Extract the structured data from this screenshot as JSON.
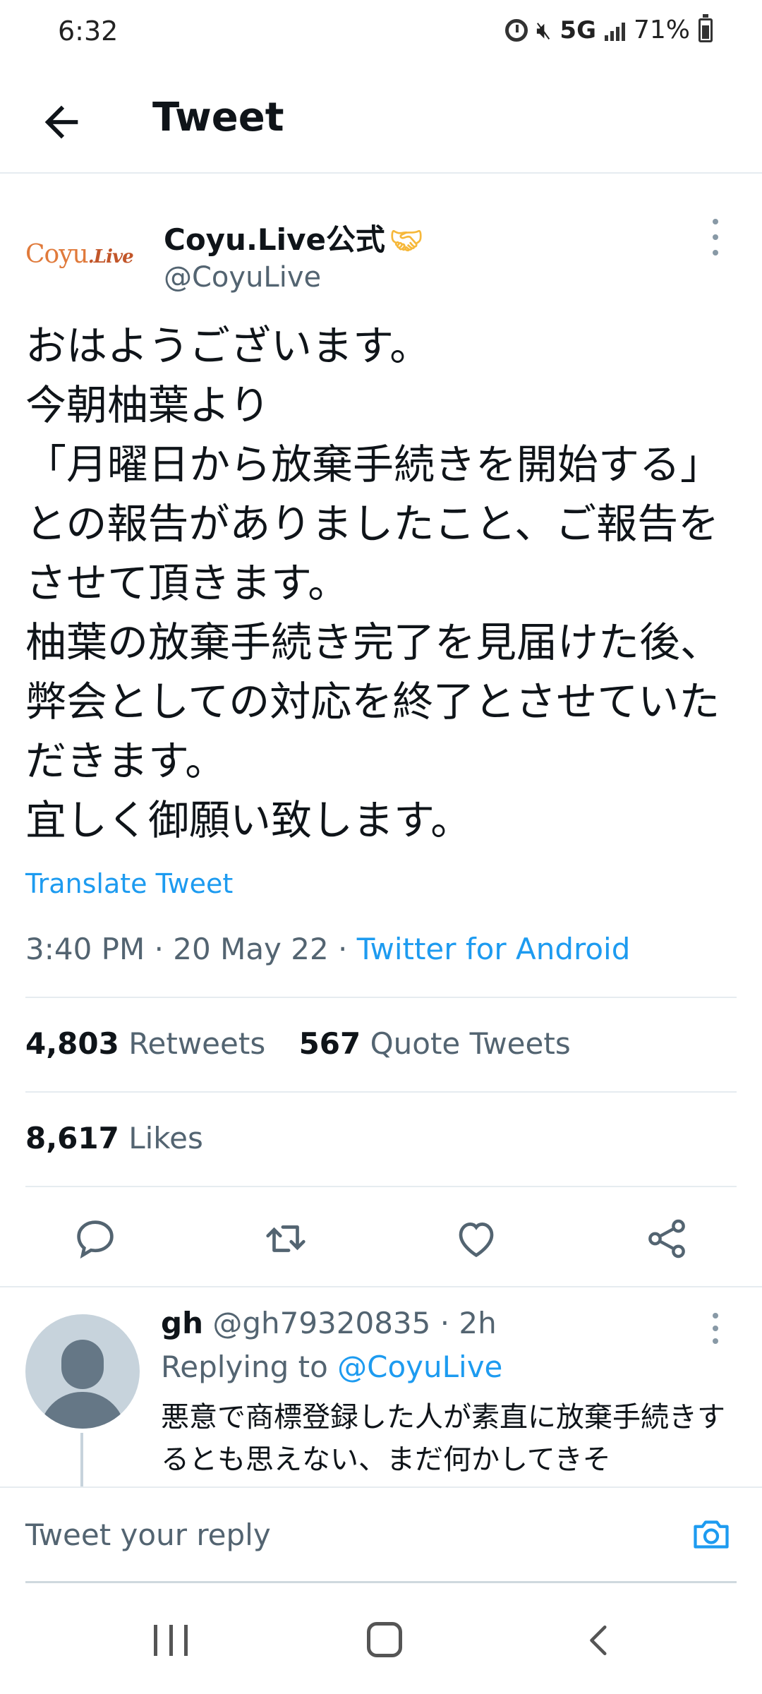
{
  "status_bar": {
    "time": "6:32",
    "network": "5G",
    "battery": "71%"
  },
  "app_bar": {
    "title": "Tweet"
  },
  "tweet": {
    "logo_text": "Coyu",
    "logo_text_accent": ".Live",
    "display_name": "Coyu.Live公式",
    "handle": "@CoyuLive",
    "text": "おはようございます。\n今朝柚葉より\n「月曜日から放棄手続きを開始する」との報告がありましたこと、ご報告をさせて頂きます。\n柚葉の放棄手続き完了を見届けた後、弊会としての対応を終了とさせていただきます。\n宜しく御願い致します。",
    "translate_label": "Translate Tweet",
    "timestamp": "3:40 PM · 20 May 22 · ",
    "source": "Twitter for Android",
    "retweets_count": "4,803",
    "retweets_label": "Retweets",
    "quotes_count": "567",
    "quotes_label": "Quote Tweets",
    "likes_count": "8,617",
    "likes_label": "Likes"
  },
  "reply": {
    "name": "gh",
    "handle_time": " @gh79320835 · 2h",
    "replying_prefix": "Replying to ",
    "replying_to": "@CoyuLive",
    "text": "悪意で商標登録した人が素直に放棄手続きするとも思えない、まだ何かしてきそ"
  },
  "composer": {
    "placeholder": "Tweet your reply"
  },
  "colors": {
    "accent": "#1d9bf0",
    "text": "#0f1419",
    "secondary": "#536471",
    "logo": "#e07a3b"
  },
  "icons": [
    "alarm-icon",
    "mute-icon",
    "signal-icon",
    "battery-icon",
    "back-arrow-icon",
    "more-vertical-icon",
    "handshake-icon",
    "reply-icon",
    "retweet-icon",
    "like-icon",
    "share-icon",
    "camera-icon",
    "recents-icon",
    "home-icon",
    "nav-back-icon"
  ]
}
